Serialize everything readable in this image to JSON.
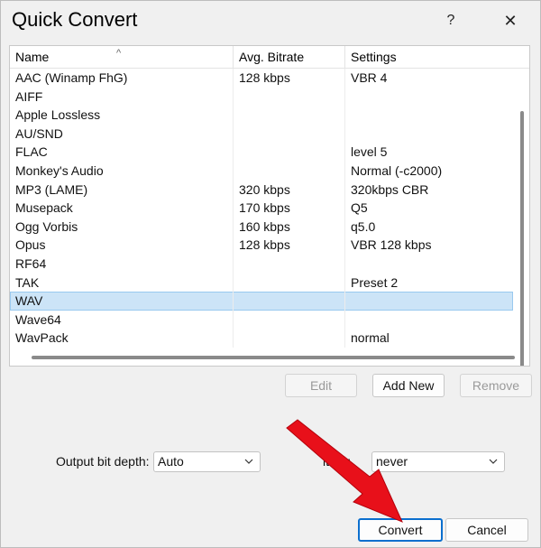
{
  "window": {
    "title": "Quick Convert",
    "help_label": "?",
    "close_label": "✕"
  },
  "list": {
    "columns": [
      "Name",
      "Avg. Bitrate",
      "Settings"
    ],
    "sort_indicator": "^",
    "rows": [
      {
        "name": "AAC (Winamp FhG)",
        "bitrate": "128 kbps",
        "settings": "VBR 4"
      },
      {
        "name": "AIFF",
        "bitrate": "",
        "settings": ""
      },
      {
        "name": "Apple Lossless",
        "bitrate": "",
        "settings": ""
      },
      {
        "name": "AU/SND",
        "bitrate": "",
        "settings": ""
      },
      {
        "name": "FLAC",
        "bitrate": "",
        "settings": "level 5"
      },
      {
        "name": "Monkey's Audio",
        "bitrate": "",
        "settings": "Normal (-c2000)"
      },
      {
        "name": "MP3 (LAME)",
        "bitrate": "320 kbps",
        "settings": "320kbps CBR"
      },
      {
        "name": "Musepack",
        "bitrate": "170 kbps",
        "settings": "Q5"
      },
      {
        "name": "Ogg Vorbis",
        "bitrate": "160 kbps",
        "settings": "q5.0"
      },
      {
        "name": "Opus",
        "bitrate": "128 kbps",
        "settings": "VBR 128 kbps"
      },
      {
        "name": "RF64",
        "bitrate": "",
        "settings": ""
      },
      {
        "name": "TAK",
        "bitrate": "",
        "settings": "Preset 2"
      },
      {
        "name": "WAV",
        "bitrate": "",
        "settings": "",
        "selected": true
      },
      {
        "name": "Wave64",
        "bitrate": "",
        "settings": ""
      },
      {
        "name": "WavPack",
        "bitrate": "",
        "settings": "normal"
      }
    ]
  },
  "buttons": {
    "edit": "Edit",
    "add_new": "Add New",
    "remove": "Remove",
    "convert": "Convert",
    "cancel": "Cancel"
  },
  "options": {
    "bit_depth_label": "Output bit depth:",
    "bit_depth_value": "Auto",
    "dither_label": "ither:",
    "dither_value": "never"
  },
  "colors": {
    "selection": "#cce4f7",
    "annotation_arrow": "#e8101a",
    "default_button_border": "#0b6fce"
  }
}
